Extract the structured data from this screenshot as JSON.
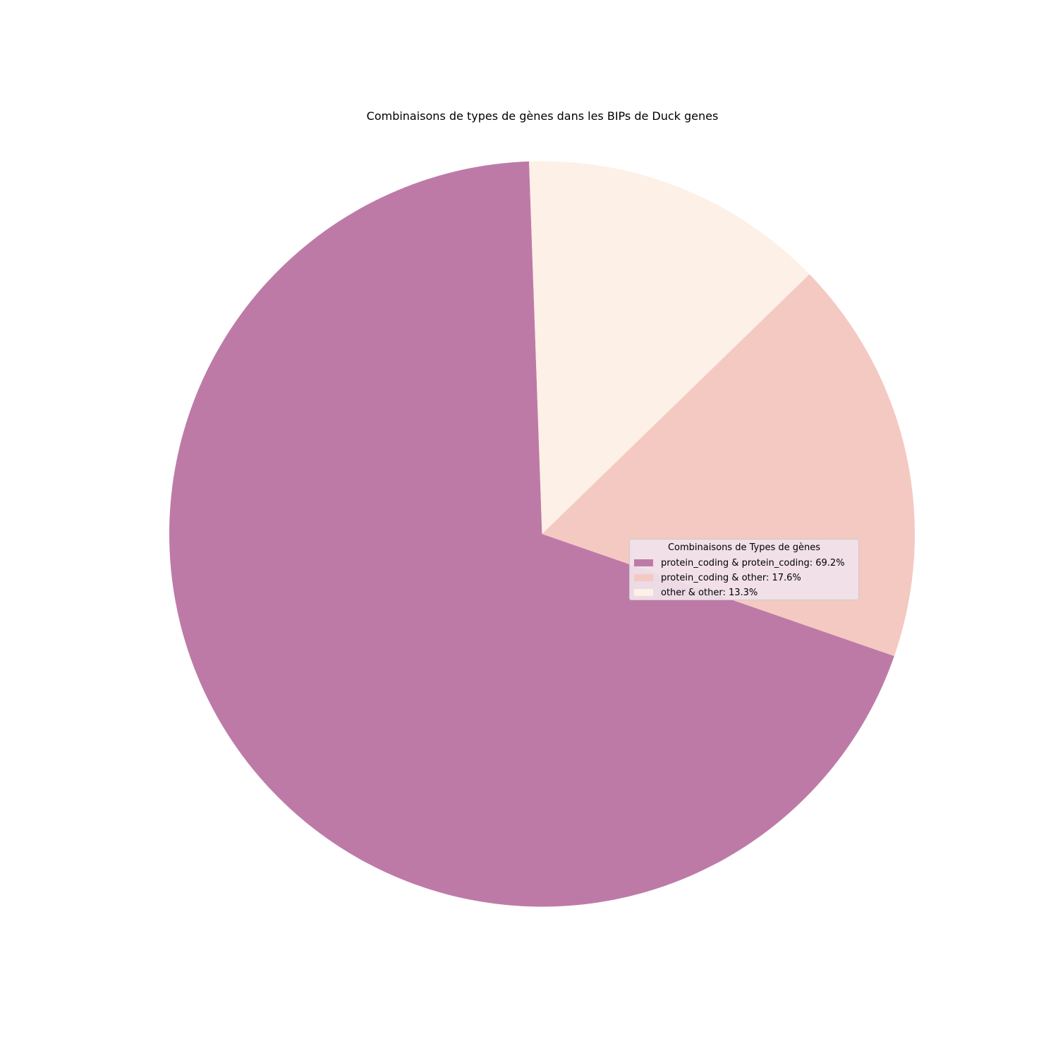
{
  "chart_data": {
    "type": "pie",
    "title": "Combinaisons de types de gènes dans les BIPs de Duck genes",
    "slices": [
      {
        "label": "protein_coding & protein_coding",
        "value": 69.2,
        "color": "#be7aa7",
        "legend_text": "protein_coding & protein_coding: 69.2%"
      },
      {
        "label": "protein_coding & other",
        "value": 17.6,
        "color": "#f4c9c2",
        "legend_text": "protein_coding & other: 17.6%"
      },
      {
        "label": "other & other",
        "value": 13.3,
        "color": "#fdf0e6",
        "legend_text": "other & other: 13.3%"
      }
    ],
    "legend": {
      "title": "Combinaisons de Types de gènes",
      "placement": "center-right"
    }
  }
}
